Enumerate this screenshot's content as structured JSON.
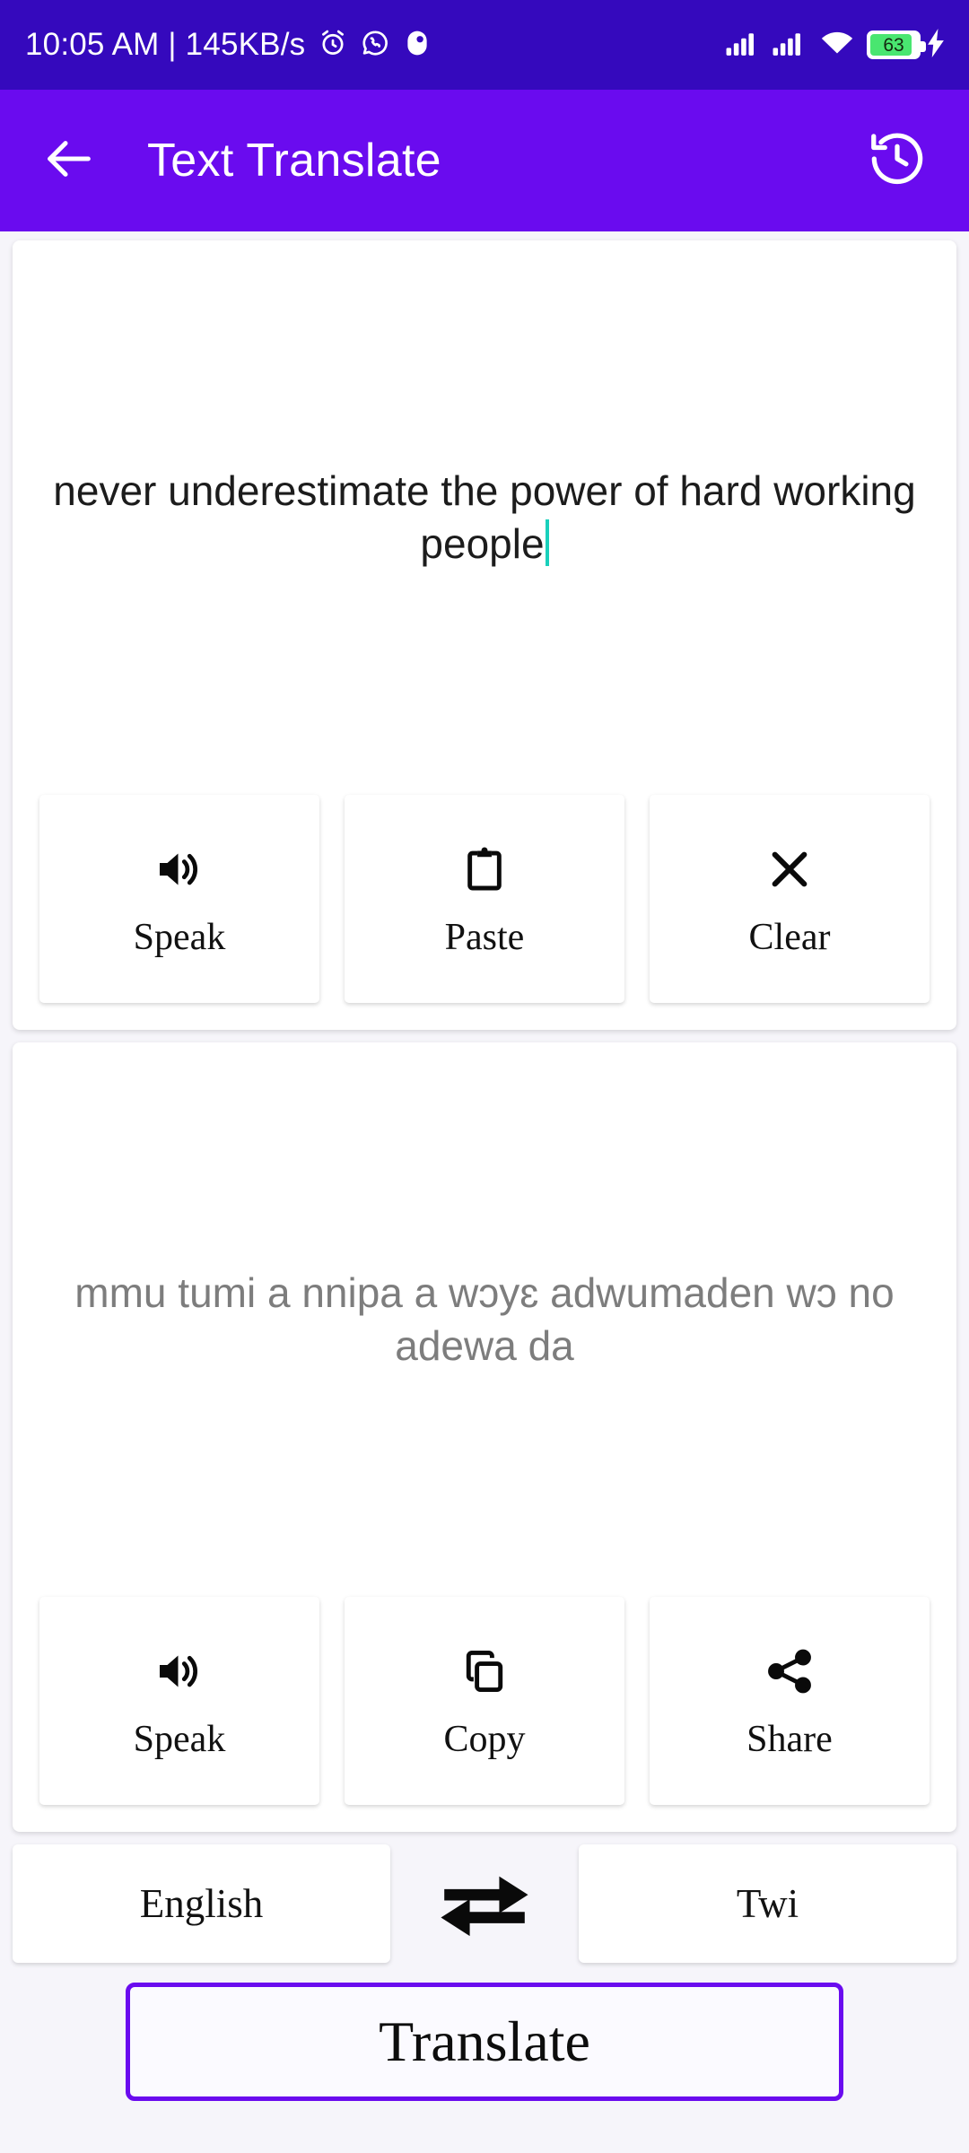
{
  "status_bar": {
    "clock": "10:05 AM | 145KB/s",
    "battery_percent": "63",
    "icons": [
      "alarm-icon",
      "whatsapp-icon",
      "app-badge-icon",
      "signal-1-icon",
      "signal-2-icon",
      "wifi-icon",
      "battery-icon",
      "charging-bolt-icon"
    ],
    "background_color": "#3509BD"
  },
  "app_bar": {
    "title": "Text Translate",
    "back_icon": "arrow-left-icon",
    "history_icon": "history-clock-icon",
    "background_color": "#6A0BEF"
  },
  "input_panel": {
    "text": "never underestimate the power of hard working people",
    "caret_color": "#19d0bb",
    "actions": [
      {
        "label": "Speak",
        "icon": "volume-speaker-icon"
      },
      {
        "label": "Paste",
        "icon": "clipboard-icon"
      },
      {
        "label": "Clear",
        "icon": "close-x-icon"
      }
    ]
  },
  "output_panel": {
    "text": "mmu tumi a nnipa a wɔyɛ adwumaden wɔ no adewa da",
    "text_color": "#7d7d7d",
    "actions": [
      {
        "label": "Speak",
        "icon": "volume-speaker-icon"
      },
      {
        "label": "Copy",
        "icon": "copy-icon"
      },
      {
        "label": "Share",
        "icon": "share-nodes-icon"
      }
    ]
  },
  "language_row": {
    "source_language": "English",
    "target_language": "Twi",
    "swap_icon": "swap-horizontal-arrows-icon"
  },
  "translate_button": {
    "label": "Translate",
    "border_color": "#6A0BEF"
  }
}
